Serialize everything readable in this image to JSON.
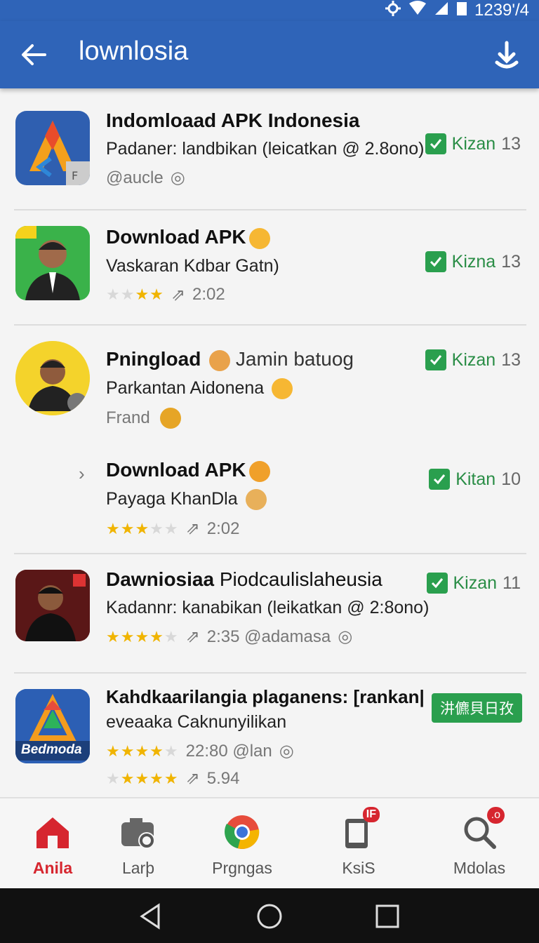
{
  "status": {
    "time": "1239'/4"
  },
  "appbar": {
    "title": "lownlosia"
  },
  "items": [
    {
      "title": "Indomloaad APK Indonesia",
      "subtitle": "Padaner: landbikan (leicatkan @ 2.8ono)",
      "meta": "@aucle",
      "badge_label": "Kizan",
      "badge_num": "13"
    },
    {
      "title": "Download APK",
      "subtitle": "Vaskaran Kdbar Gatn)",
      "meta": "2:02",
      "rating": 2,
      "badge_label": "Kizna",
      "badge_num": "13"
    },
    {
      "title": "Pningload",
      "title_extra": "Jamin batuog",
      "subtitle": "Parkantan Aidonena",
      "meta": "Frand",
      "badge_label": "Kizan",
      "badge_num": "13"
    },
    {
      "title": "Download APK",
      "subtitle": "Payaga KhanDla",
      "meta": "2:02",
      "rating": 3,
      "badge_label": "Kitan",
      "badge_num": "10"
    },
    {
      "title": "Dawniosiaa",
      "title_extra": "Piodcaulislaheusia",
      "subtitle": "Kadannr: kanabikan (leikatkan @ 2:8ono)",
      "meta": "2:35 @adamasa",
      "rating": 4,
      "badge_label": "Kizan",
      "badge_num": "11"
    },
    {
      "title": "Kahdkaarilangia plaganens: [rankan|",
      "subtitle": "eveaaka Caknunyilikan",
      "meta": "22:80 @lan",
      "meta2": "5.94",
      "rating": 4,
      "badge_label": "汫儦貝日孜",
      "icon_text": "Bedmoda"
    }
  ],
  "nav": [
    {
      "label": "Anila",
      "active": true
    },
    {
      "label": "Larþ"
    },
    {
      "label": "Prgngas"
    },
    {
      "label": "KsiS",
      "badge": "IF"
    },
    {
      "label": "Mdolas",
      "badge": ".o"
    }
  ],
  "colors": {
    "primary": "#2f64b8",
    "accent": "#d6262f",
    "green": "#2a9f4e"
  }
}
